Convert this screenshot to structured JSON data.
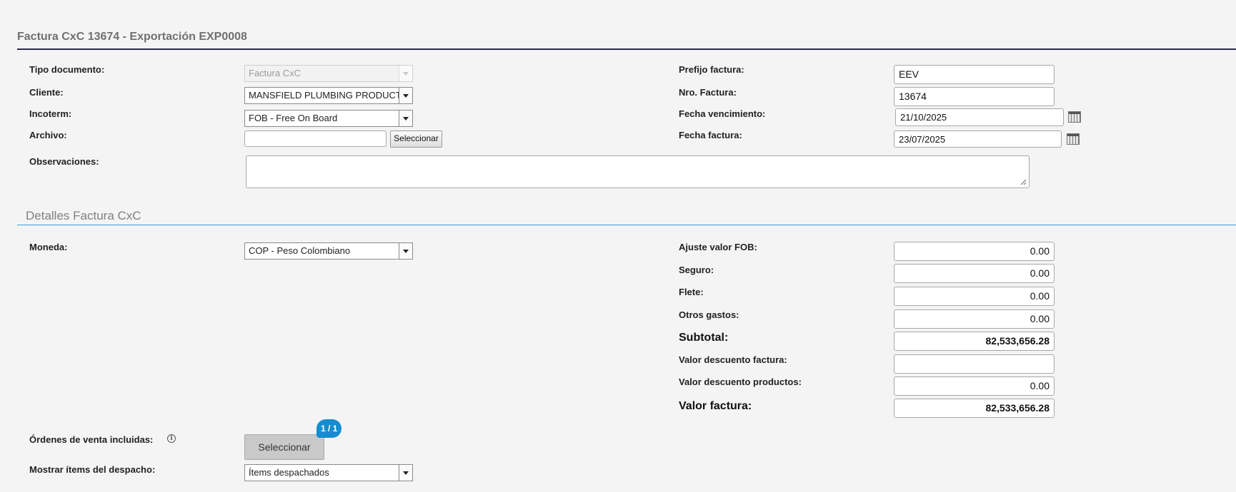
{
  "header": {
    "title": "Factura CxC 13674 - Exportación EXP0008"
  },
  "form": {
    "tipo_documento": {
      "label": "Tipo documento:",
      "value": "Factura CxC"
    },
    "cliente": {
      "label": "Cliente:",
      "value": "MANSFIELD PLUMBING PRODUCTS"
    },
    "incoterm": {
      "label": "Incoterm:",
      "value": "FOB - Free On Board"
    },
    "archivo": {
      "label": "Archivo:",
      "value": "",
      "button": "Seleccionar"
    },
    "observaciones": {
      "label": "Observaciones:",
      "value": ""
    },
    "prefijo_factura": {
      "label": "Prefijo factura:",
      "value": "EEV"
    },
    "nro_factura": {
      "label": "Nro. Factura:",
      "value": "13674"
    },
    "fecha_vencimiento": {
      "label": "Fecha vencimiento:",
      "value": "21/10/2025"
    },
    "fecha_factura": {
      "label": "Fecha factura:",
      "value": "23/07/2025"
    }
  },
  "details": {
    "section_title": "Detalles Factura CxC",
    "moneda": {
      "label": "Moneda:",
      "value": "COP - Peso Colombiano"
    },
    "ajuste_fob": {
      "label": "Ajuste valor FOB:",
      "value": "0.00"
    },
    "seguro": {
      "label": "Seguro:",
      "value": "0.00"
    },
    "flete": {
      "label": "Flete:",
      "value": "0.00"
    },
    "otros_gastos": {
      "label": "Otros gastos:",
      "value": "0.00"
    },
    "subtotal": {
      "label": "Subtotal:",
      "value": "82,533,656.28"
    },
    "descuento_factura": {
      "label": "Valor descuento factura:",
      "value": ""
    },
    "descuento_productos": {
      "label": "Valor descuento productos:",
      "value": "0.00"
    },
    "valor_factura": {
      "label": "Valor factura:",
      "value": "82,533,656.28"
    },
    "ordenes": {
      "label": "Órdenes de venta incluidas:",
      "button": "Seleccionar",
      "badge": "1 / 1"
    },
    "mostrar_items": {
      "label": "Mostrar ítems del despacho:",
      "value": "Ítems despachados"
    }
  },
  "icons": {
    "calendar": "calendar-icon",
    "info": "info-icon",
    "dropdown": "chevron-down-icon",
    "resize": "resize-grip-icon"
  },
  "colors": {
    "accent": "#168dd0",
    "title_rule": "#2a2d4a",
    "section_rule": "#3a9fd6"
  }
}
